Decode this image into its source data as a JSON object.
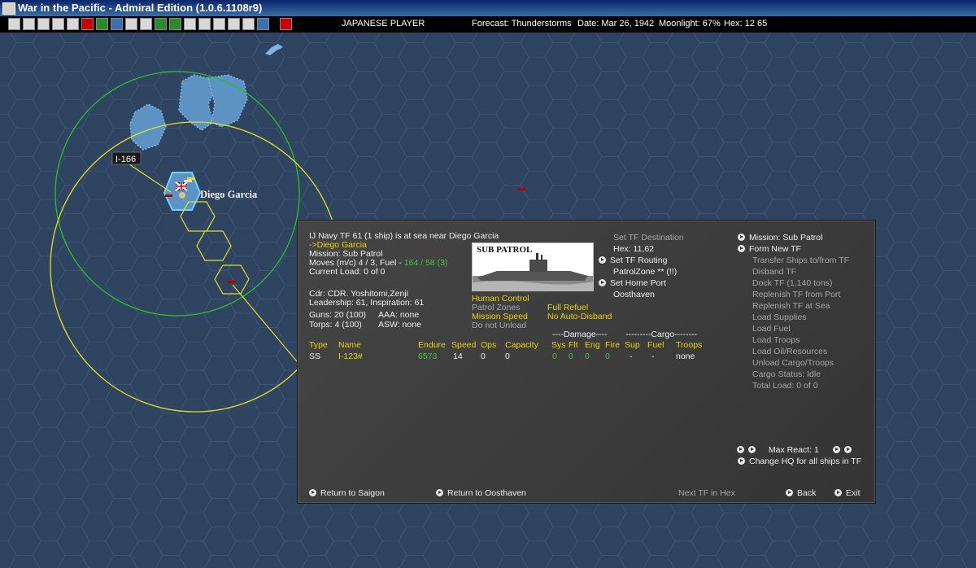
{
  "window": {
    "title": "War in the Pacific - Admiral Edition (1.0.6.1108r9)"
  },
  "toolbar": {
    "player": "JAPANESE PLAYER",
    "forecast": "Forecast: Thunderstorms",
    "date": "Date: Mar 26, 1942",
    "moonlight": "Moonlight: 67%",
    "hex": "Hex: 12  65"
  },
  "map": {
    "base_name": "Diego Garcia",
    "unit_label": "I-166"
  },
  "tf": {
    "header": "IJ Navy TF 61 (1 ship) is at sea near Diego Garcia",
    "destination": "->Diego Garcia",
    "mission": "Mission: Sub Patrol",
    "moves_prefix": "Moves (m/c)  4 / 3, Fuel - ",
    "moves_fuel": "164 / 58 (3)",
    "current_load": "Current Load: 0 of 0",
    "cdr": "Cdr: CDR. Yoshitomi,Zenji",
    "leadership": "Leadership: 61, Inspiration: 61",
    "guns": "Guns: 20 (100)",
    "aaa": "AAA: none",
    "torps": "Torps: 4 (100)",
    "asw": "ASW: none",
    "image_label": "SUB PATROL",
    "human_control": "Human Control",
    "patrol_zones": "Patrol Zones",
    "mission_speed": "Mission Speed",
    "do_not_unload": "Do not Unload",
    "full_refuel": "Full Refuel",
    "no_auto_disband": "No Auto-Disband",
    "set_tf_destination": "Set TF Destination",
    "dest_hex": "Hex: 11,62",
    "set_tf_routing": "Set TF Routing",
    "patrol_zone": "PatrolZone  ** (!!)",
    "set_home_port": "Set Home Port",
    "home_port": "Oosthaven"
  },
  "right_menu": {
    "mission": "Mission: Sub Patrol",
    "form_new_tf": "Form New TF",
    "items": [
      "Transfer Ships to/from TF",
      "Disband TF",
      "Dock TF (1,140 tons)",
      "Replenish TF from Port",
      "Replenish TF at Sea",
      "Load Supplies",
      "Load Fuel",
      "Load Troops",
      "Load Oil/Resources",
      "Unload Cargo/Troops",
      "Cargo Status: Idle",
      "Total Load: 0 of 0"
    ],
    "max_react": "Max React:  1",
    "change_hq": "Change HQ for all ships in TF"
  },
  "ships_table": {
    "damage_group": "----Damage----",
    "cargo_group": "---------Cargo--------",
    "headers": {
      "type": "Type",
      "name": "Name",
      "endure": "Endure",
      "speed": "Speed",
      "ops": "Ops",
      "capacity": "Capacity",
      "sys": "Sys",
      "flt": "Flt",
      "eng": "Eng",
      "fire": "Fire",
      "sup": "Sup",
      "fuel": "Fuel",
      "troops": "Troops"
    },
    "rows": [
      {
        "type": "SS",
        "name": "I-123#",
        "endure": "6573",
        "speed": "14",
        "ops": "0",
        "capacity": "0",
        "sys": "0",
        "flt": "0",
        "eng": "0",
        "fire": "0",
        "sup": "-",
        "fuel": "-",
        "troops": "none"
      }
    ]
  },
  "footer": {
    "return_saigon": "Return to Saigon",
    "return_oosthaven": "Return to Oosthaven",
    "next_tf": "Next TF in Hex",
    "back": "Back",
    "exit": "Exit"
  }
}
